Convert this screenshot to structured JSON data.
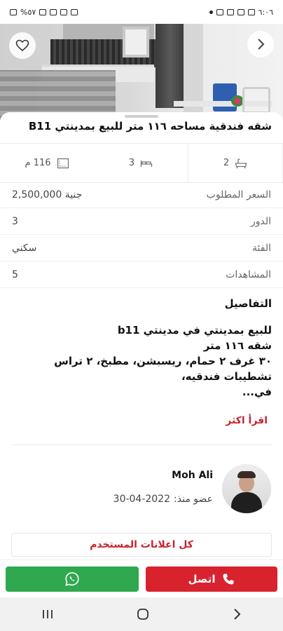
{
  "status_bar": {
    "time": "٦:٠٦",
    "battery": "%٥٧"
  },
  "listing": {
    "title": "شقه فندقية مساحه ١١٦ متر للبيع بمدينتي B11",
    "specs": [
      {
        "icon": "area-icon",
        "value": "116 م"
      },
      {
        "icon": "bed-icon",
        "value": "3"
      },
      {
        "icon": "bath-icon",
        "value": "2"
      }
    ],
    "price": {
      "label": "السعر المطلوب",
      "value": "2,500,000 جنية"
    },
    "floor": {
      "label": "الدور",
      "value": "3"
    },
    "category": {
      "label": "الفئة",
      "value": "سكني"
    },
    "views": {
      "label": "المشاهدات",
      "value": "5"
    },
    "details_heading": "التفاصيل",
    "details_lines": [
      "للبيع بمدينتي في مدينتي b11",
      "شقه ١١٦ متر",
      "٣٠ غرف ٢ حمام، ريسبشن، مطبخ، ٢ تراس",
      "تشطيبات فندقيه،",
      "في..."
    ],
    "read_more": "اقرأ اكثر"
  },
  "seller": {
    "name": "Moh Ali",
    "member_since_label": "عضو منذ:",
    "member_since_date": "30-04-2022",
    "all_ads_label": "كل اعلانات المستخدم"
  },
  "actions": {
    "call_label": "اتصل",
    "whatsapp_icon": "whatsapp-icon"
  },
  "colors": {
    "primary_red": "#d8232f",
    "whatsapp_green": "#2fa84f",
    "link_red": "#c8232c"
  }
}
